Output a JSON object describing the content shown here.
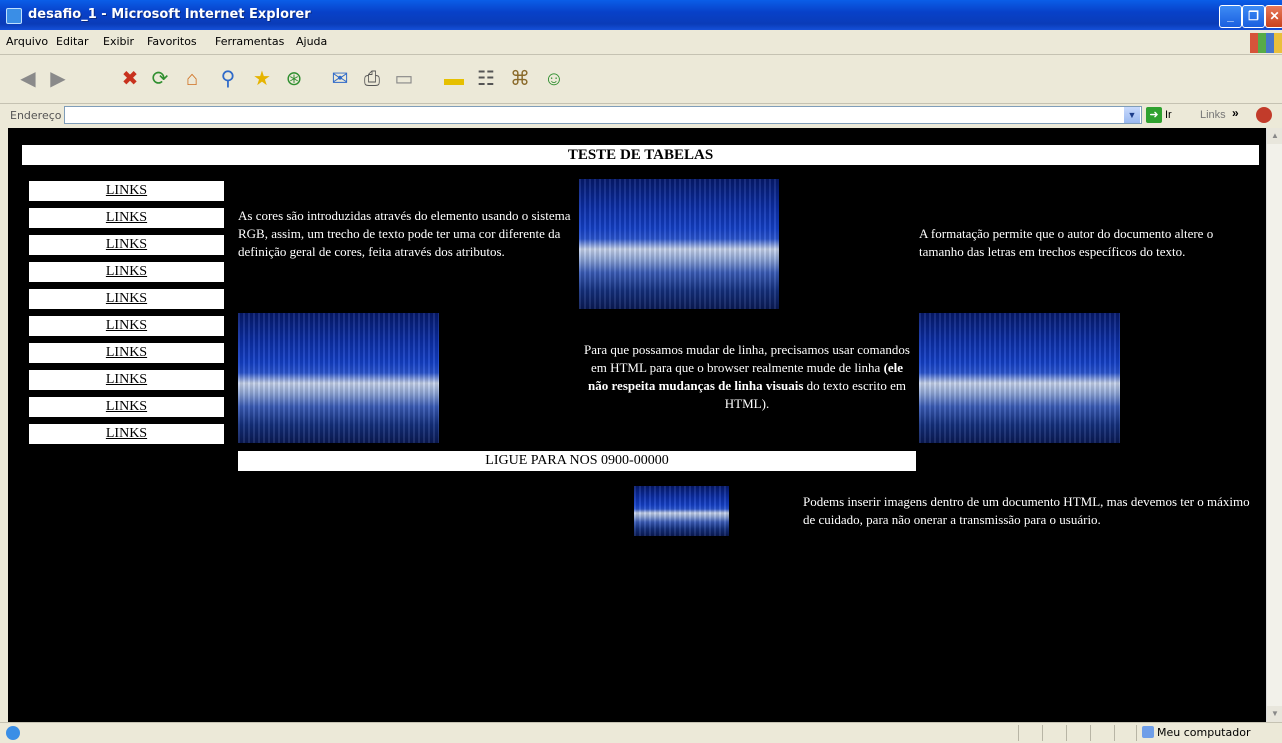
{
  "window": {
    "title": "desafio_1 - Microsoft Internet Explorer",
    "min": "_",
    "max": "❐",
    "close": "✕"
  },
  "menu": [
    "Arquivo",
    "Editar",
    "Exibir",
    "Favoritos",
    "Ferramentas",
    "Ajuda"
  ],
  "toolbar": {
    "icons": [
      "back-icon",
      "forward-icon",
      "stop-icon",
      "refresh-icon",
      "home-icon",
      "search-icon",
      "favorites-icon",
      "history-icon",
      "mail-icon",
      "print-icon",
      "edit-icon",
      "notes-icon",
      "messenger-icon",
      "research-icon",
      "contacts-icon"
    ],
    "glyphs": [
      "◀",
      "▶",
      "✖",
      "⟳",
      "⌂",
      "⚲",
      "★",
      "⊛",
      "✉",
      "⎙",
      "▭",
      "▬",
      "☷",
      "⌘",
      "☺"
    ]
  },
  "address": {
    "label": "Endereço",
    "value": "",
    "go_label": "Ir",
    "links_label": "Links",
    "chevron": "»"
  },
  "page": {
    "heading": "TESTE DE TABELAS",
    "links": [
      "LINKS",
      "LINKS",
      "LINKS",
      "LINKS",
      "LINKS",
      "LINKS",
      "LINKS",
      "LINKS",
      "LINKS",
      "LINKS"
    ],
    "para1": "As cores são introduzidas através do elemento usando o sistema RGB, assim, um trecho de texto pode ter uma cor diferente da definição geral de cores, feita através dos atributos.",
    "para2": "A formatação permite que o autor do documento altere o tamanho das letras em trechos específicos do texto.",
    "para3_a": "Para que possamos mudar de linha, precisamos usar comandos em HTML para que o browser realmente mude de linha ",
    "para3_bold": "(ele não respeita mudanças de linha visuais",
    "para3_b": " do texto escrito em HTML).",
    "phone": "LIGUE PARA NOS 0900-00000",
    "para4": "Podems inserir imagens dentro de um documento HTML, mas devemos ter o máximo de cuidado, para não onerar a transmissão para o usuário."
  },
  "status": {
    "text": "",
    "zone": "Meu computador"
  },
  "colors": {
    "titlebar": "#0a3cb8",
    "content_bg": "#000000",
    "link_bg": "#ffffff"
  }
}
